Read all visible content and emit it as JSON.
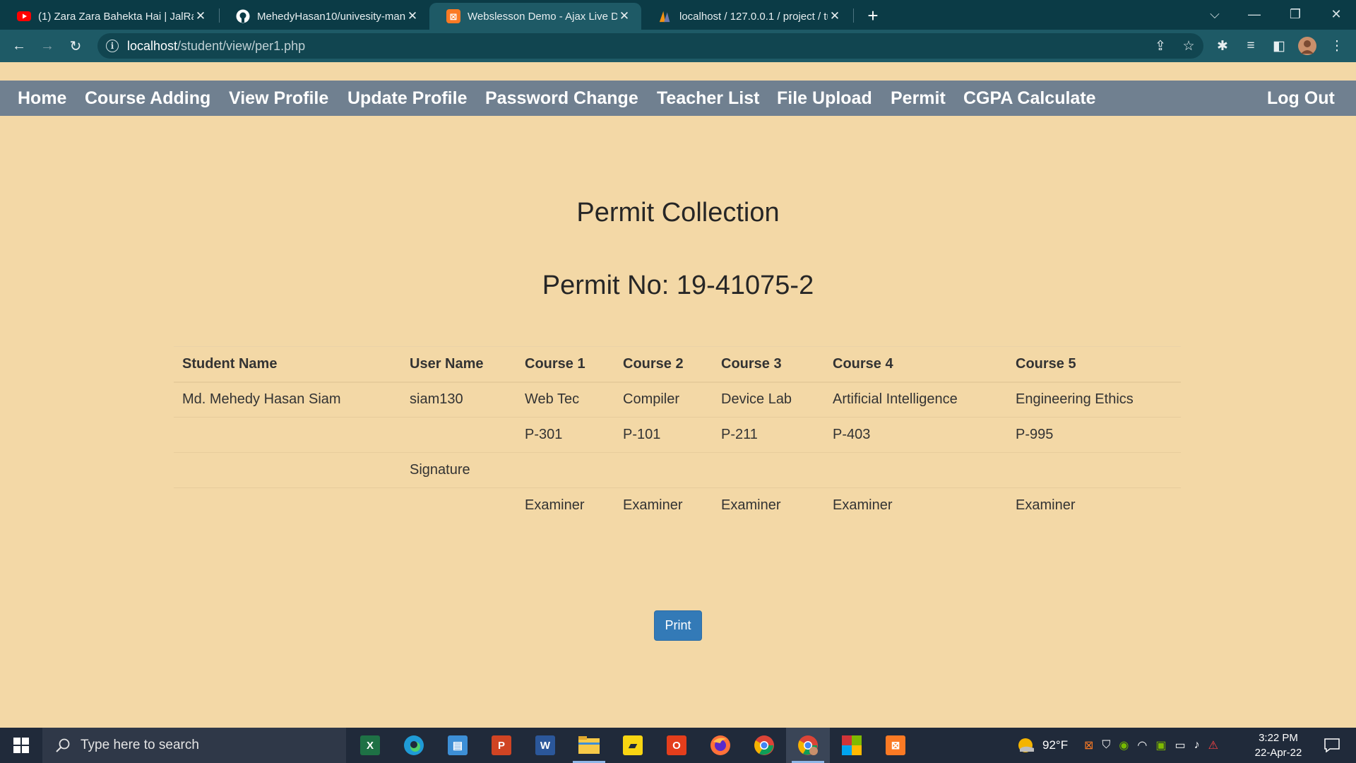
{
  "browser": {
    "tabs": [
      {
        "title": "(1) Zara Zara Bahekta Hai | JalRaj",
        "icon": "youtube-icon",
        "active": false
      },
      {
        "title": "MehedyHasan10/univesity-mana",
        "icon": "github-icon",
        "active": false
      },
      {
        "title": "Webslesson Demo - Ajax Live Da",
        "icon": "xampp-icon",
        "active": true
      },
      {
        "title": "localhost / 127.0.0.1 / project / tu",
        "icon": "phpmyadmin-icon",
        "active": false
      }
    ],
    "close_glyph": "✕",
    "new_tab_glyph": "+",
    "url_host": "localhost",
    "url_path": "/student/view/per1.php"
  },
  "nav": {
    "items": [
      {
        "label": "Home"
      },
      {
        "label": "Course Adding"
      },
      {
        "label": "View Profile"
      },
      {
        "label": "Update Profile"
      },
      {
        "label": "Password Change"
      },
      {
        "label": "Teacher List"
      },
      {
        "label": "File Upload"
      },
      {
        "label": "Permit"
      },
      {
        "label": "CGPA Calculate"
      }
    ],
    "logout": "Log Out"
  },
  "page": {
    "title": "Permit Collection",
    "permit_no": "Permit No: 19-41075-2",
    "print_label": "Print"
  },
  "table": {
    "headers": [
      "Student Name",
      "User Name",
      "Course 1",
      "Course 2",
      "Course 3",
      "Course 4",
      "Course 5"
    ],
    "rows": [
      [
        "Md. Mehedy Hasan Siam",
        "siam130",
        "Web Tec",
        "Compiler",
        "Device Lab",
        "Artificial Intelligence",
        "Engineering Ethics"
      ],
      [
        "",
        "",
        "P-301",
        "P-101",
        "P-211",
        "P-403",
        "P-995"
      ],
      [
        "",
        "Signature",
        "",
        "",
        "",
        "",
        ""
      ],
      [
        "",
        "",
        "Examiner",
        "Examiner",
        "Examiner",
        "Examiner",
        "Examiner"
      ]
    ]
  },
  "taskbar": {
    "search_placeholder": "Type here to search",
    "temperature": "92°F",
    "time": "3:22 PM",
    "date": "22-Apr-22"
  },
  "colors": {
    "page_bg": "#f3d8a6",
    "navbar_bg": "#708090",
    "print_button": "#337ab7",
    "browser_frame": "#0b3b46"
  }
}
